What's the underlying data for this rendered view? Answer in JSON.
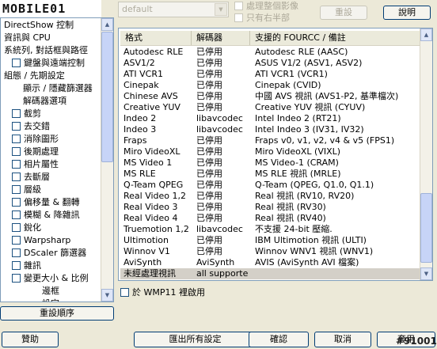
{
  "logo": {
    "text": "MOBILE01"
  },
  "sidebar": {
    "items": [
      {
        "label": "DirectShow 控制",
        "checkbox": false,
        "indent": 0
      },
      {
        "label": "資訊與 CPU",
        "checkbox": false,
        "indent": 0
      },
      {
        "label": "系統列, 對話框與路徑",
        "checkbox": false,
        "indent": 0
      },
      {
        "label": "鍵盤與遠端控制",
        "checkbox": true,
        "indent": 1
      },
      {
        "label": "組態 / 先期設定",
        "checkbox": false,
        "indent": 0
      },
      {
        "label": "顯示 / 隱藏篩選器",
        "checkbox": false,
        "indent": 2
      },
      {
        "label": "解碼器選項",
        "checkbox": false,
        "indent": 2
      },
      {
        "label": "截剪",
        "checkbox": true,
        "indent": 1
      },
      {
        "label": "去交錯",
        "checkbox": true,
        "indent": 1
      },
      {
        "label": "消除圖形",
        "checkbox": true,
        "indent": 1
      },
      {
        "label": "後期處理",
        "checkbox": true,
        "indent": 1
      },
      {
        "label": "相片屬性",
        "checkbox": true,
        "indent": 1
      },
      {
        "label": "去斷層",
        "checkbox": true,
        "indent": 1
      },
      {
        "label": "層級",
        "checkbox": true,
        "indent": 1
      },
      {
        "label": "偏移量 & 翻轉",
        "checkbox": true,
        "indent": 1
      },
      {
        "label": "模糊 & 降雜訊",
        "checkbox": true,
        "indent": 1
      },
      {
        "label": "銳化",
        "checkbox": true,
        "indent": 1
      },
      {
        "label": "Warpsharp",
        "checkbox": true,
        "indent": 1
      },
      {
        "label": "DScaler 篩選器",
        "checkbox": true,
        "indent": 1
      },
      {
        "label": "雜訊",
        "checkbox": true,
        "indent": 1
      },
      {
        "label": "變更大小 & 比例",
        "checkbox": true,
        "indent": 1
      },
      {
        "label": "邊框",
        "checkbox": false,
        "indent": 3
      },
      {
        "label": "設定",
        "checkbox": false,
        "indent": 3
      }
    ],
    "reset_order_label": "重設順序"
  },
  "top": {
    "preset_value": "default",
    "option1": "處理整個影像",
    "option2": "只有右半部",
    "reset_label": "重設",
    "help_label": "說明"
  },
  "table": {
    "headers": [
      "格式",
      "解碼器",
      "支援的 FOURCC / 備註"
    ],
    "rows": [
      [
        "Autodesc RLE",
        "已停用",
        "Autodesc RLE (AASC)"
      ],
      [
        "ASV1/2",
        "已停用",
        "ASUS V1/2 (ASV1, ASV2)"
      ],
      [
        "ATI VCR1",
        "已停用",
        "ATI VCR1 (VCR1)"
      ],
      [
        "Cinepak",
        "已停用",
        "Cinepak (CVID)"
      ],
      [
        "Chinese AVS",
        "已停用",
        "中國 AVS 視訊 (AVS1-P2, 基準檔次)"
      ],
      [
        "Creative YUV",
        "已停用",
        "Creative YUV 視訊 (CYUV)"
      ],
      [
        "Indeo 2",
        "libavcodec",
        "Intel Indeo 2 (RT21)"
      ],
      [
        "Indeo 3",
        "libavcodec",
        "Intel Indeo 3 (IV31, IV32)"
      ],
      [
        "Fraps",
        "已停用",
        "Fraps v0, v1, v2, v4 & v5 (FPS1)"
      ],
      [
        "Miro VideoXL",
        "已停用",
        "Miro VideoXL (VIXL)"
      ],
      [
        "MS Video 1",
        "已停用",
        "MS Video-1 (CRAM)"
      ],
      [
        "MS RLE",
        "已停用",
        "MS RLE 視訊 (MRLE)"
      ],
      [
        "Q-Team QPEG",
        "已停用",
        "Q-Team (QPEG, Q1.0, Q1.1)"
      ],
      [
        "Real Video 1,2",
        "已停用",
        "Real 視訊 (RV10, RV20)"
      ],
      [
        "Real Video 3",
        "已停用",
        "Real 視訊 (RV30)"
      ],
      [
        "Real Video 4",
        "已停用",
        "Real 視訊 (RV40)"
      ],
      [
        "Truemotion 1,2",
        "libavcodec",
        "不支援 24-bit 壓縮."
      ],
      [
        "Ultimotion",
        "已停用",
        "IBM Ultimotion 視訊 (ULTI)"
      ],
      [
        "Winnov V1",
        "已停用",
        "Winnov WNV1 視訊 (WNV1)"
      ],
      [
        "AviSynth",
        "AviSynth",
        "AVIS (AviSynth AVI 檔案)"
      ],
      [
        "未經處理視訊",
        "all supported",
        ""
      ]
    ],
    "selected_row": 20
  },
  "wmp_label": "於 WMP11 裡啟用",
  "buttons": {
    "donate": "贊助",
    "export": "匯出所有設定",
    "ok": "確認",
    "cancel": "取消",
    "apply": "套用"
  },
  "counter_text": "#91001"
}
